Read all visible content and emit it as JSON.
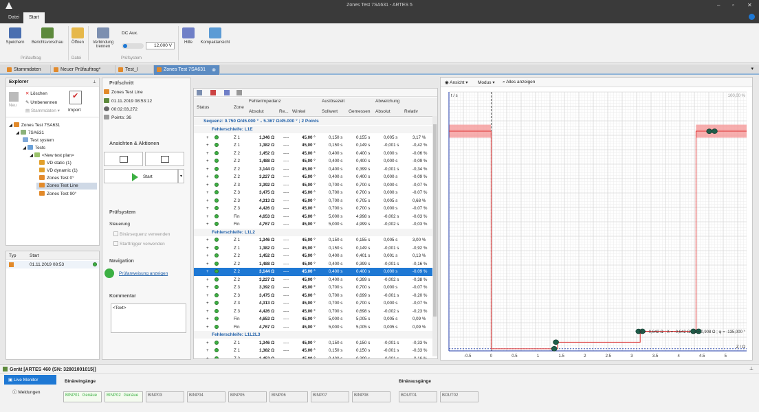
{
  "window": {
    "title": "Zones Test 7SA631 - ARTES 5"
  },
  "ribbon_tabs": [
    "Datei",
    "Start"
  ],
  "ribbon": {
    "speichern": "Speichern",
    "bericht": "Berichtsvorschau",
    "oeffnen": "Öffnen",
    "verbindung": "Verbindung trennen",
    "dc_aux": "DC Aux.",
    "dc_value": "12,000 V",
    "hilfe": "Hilfe",
    "kompakt": "Kompaktansicht",
    "grp_pruefauftrag": "Prüfauftrag",
    "grp_datei": "Datei",
    "grp_pruefsystem": "Prüfsystem"
  },
  "doc_tabs": [
    "Stammdaten",
    "Neuer Prüfauftrag*",
    "Test_I",
    "Zones Test 7SA631"
  ],
  "explorer": {
    "title": "Explorer",
    "neu": "Neu",
    "loeschen": "Löschen",
    "umbenennen": "Umbenennen",
    "stammdaten": "Stammdaten",
    "import": "Import",
    "tree": [
      "Zones Test 7SA631",
      "7SA631",
      "Test system",
      "Tests",
      "<New test plan>",
      "VD static (1)",
      "VD dynamic (1)",
      "Zones Test 0°",
      "Zones Test Line",
      "Zones Test 90°"
    ]
  },
  "history": {
    "col_typ": "Typ",
    "col_start": "Start",
    "row_start": "01.11.2019 08:53"
  },
  "pruefschritt": {
    "title": "Prüfschritt",
    "name": "Zones Test Line",
    "date": "01.11.2019 08:53:12",
    "duration": "00:02:03,272",
    "points": "Points: 36"
  },
  "aktionen": {
    "title": "Ansichten & Aktionen",
    "start": "Start"
  },
  "pruefsystem": {
    "title": "Prüfsystem",
    "steuerung": "Steuerung",
    "binaer": "Binärsequenz verwenden",
    "trigger": "Starttrigger verwenden"
  },
  "navigation": {
    "title": "Navigation",
    "link": "Prüfanweisung anzeigen"
  },
  "kommentar": {
    "title": "Kommentar",
    "text": "<Text>"
  },
  "table": {
    "headers": {
      "status": "Status",
      "zone": "Zone",
      "fehlerimpedanz": "Fehlerimpedanz",
      "absolut": "Absolut",
      "re": "Re...",
      "winkel": "Winkel",
      "ausloesezeit": "Auslösezeit",
      "sollwert": "Sollwert",
      "gemessen": "Gemessen",
      "abweichung": "Abweichung",
      "abw_abs": "Absolut",
      "relativ": "Relativ"
    },
    "sequence": "Sequenz: 0.750 Ω/45.000 ° .. 5.367 Ω/45.000 ° ; 2 Points",
    "groups": [
      {
        "name": "Fehlerschleife: L1E",
        "rows": [
          [
            "Z 1",
            "1,346 Ω",
            "45,00 °",
            "0,150 s",
            "0,155 s",
            "0,005 s",
            "3,17 %"
          ],
          [
            "Z 1",
            "1,382 Ω",
            "45,00 °",
            "0,150 s",
            "0,149 s",
            "-0,001 s",
            "-0,42 %"
          ],
          [
            "Z 2",
            "1,452 Ω",
            "45,00 °",
            "0,400 s",
            "0,400 s",
            "0,000 s",
            "-0,06 %"
          ],
          [
            "Z 2",
            "1,488 Ω",
            "45,00 °",
            "0,400 s",
            "0,400 s",
            "0,000 s",
            "-0,09 %"
          ],
          [
            "Z 2",
            "3,144 Ω",
            "45,00 °",
            "0,400 s",
            "0,399 s",
            "-0,001 s",
            "-0,34 %"
          ],
          [
            "Z 2",
            "3,227 Ω",
            "45,00 °",
            "0,400 s",
            "0,400 s",
            "0,000 s",
            "-0,09 %"
          ],
          [
            "Z 3",
            "3,392 Ω",
            "45,00 °",
            "0,700 s",
            "0,700 s",
            "0,000 s",
            "-0,07 %"
          ],
          [
            "Z 3",
            "3,475 Ω",
            "45,00 °",
            "0,700 s",
            "0,700 s",
            "0,000 s",
            "-0,07 %"
          ],
          [
            "Z 3",
            "4,313 Ω",
            "45,00 °",
            "0,700 s",
            "0,705 s",
            "0,005 s",
            "0,68 %"
          ],
          [
            "Z 3",
            "4,426 Ω",
            "45,00 °",
            "0,700 s",
            "0,700 s",
            "0,000 s",
            "-0,07 %"
          ],
          [
            "Fin",
            "4,653 Ω",
            "45,00 °",
            "5,000 s",
            "4,998 s",
            "-0,002 s",
            "-0,03 %"
          ],
          [
            "Fin",
            "4,767 Ω",
            "45,00 °",
            "5,000 s",
            "4,999 s",
            "-0,002 s",
            "-0,03 %"
          ]
        ]
      },
      {
        "name": "Fehlerschleife: L1L2",
        "rows": [
          [
            "Z 1",
            "1,346 Ω",
            "45,00 °",
            "0,150 s",
            "0,155 s",
            "0,005 s",
            "3,00 %"
          ],
          [
            "Z 1",
            "1,382 Ω",
            "45,00 °",
            "0,150 s",
            "0,149 s",
            "-0,001 s",
            "-0,92 %"
          ],
          [
            "Z 2",
            "1,452 Ω",
            "45,00 °",
            "0,400 s",
            "0,401 s",
            "0,001 s",
            "0,13 %"
          ],
          [
            "Z 2",
            "1,488 Ω",
            "45,00 °",
            "0,400 s",
            "0,399 s",
            "-0,001 s",
            "-0,16 %"
          ],
          [
            "Z 2",
            "3,144 Ω",
            "45,00 °",
            "0,400 s",
            "0,400 s",
            "0,000 s",
            "-0,09 %"
          ],
          [
            "Z 2",
            "3,227 Ω",
            "45,00 °",
            "0,400 s",
            "0,399 s",
            "-0,002 s",
            "-0,38 %"
          ],
          [
            "Z 3",
            "3,392 Ω",
            "45,00 °",
            "0,700 s",
            "0,700 s",
            "0,000 s",
            "-0,07 %"
          ],
          [
            "Z 3",
            "3,475 Ω",
            "45,00 °",
            "0,700 s",
            "0,699 s",
            "-0,001 s",
            "-0,20 %"
          ],
          [
            "Z 3",
            "4,313 Ω",
            "45,00 °",
            "0,700 s",
            "0,700 s",
            "0,000 s",
            "-0,07 %"
          ],
          [
            "Z 3",
            "4,426 Ω",
            "45,00 °",
            "0,700 s",
            "0,698 s",
            "-0,002 s",
            "-0,23 %"
          ],
          [
            "Fin",
            "4,653 Ω",
            "45,00 °",
            "5,000 s",
            "5,005 s",
            "0,005 s",
            "0,09 %"
          ],
          [
            "Fin",
            "4,767 Ω",
            "45,00 °",
            "5,000 s",
            "5,005 s",
            "0,005 s",
            "0,09 %"
          ]
        ]
      },
      {
        "name": "Fehlerschleife: L1L2L3",
        "rows": [
          [
            "Z 1",
            "1,346 Ω",
            "45,00 °",
            "0,150 s",
            "0,150 s",
            "-0,001 s",
            "-0,33 %"
          ],
          [
            "Z 1",
            "1,382 Ω",
            "45,00 °",
            "0,150 s",
            "0,150 s",
            "-0,001 s",
            "-0,33 %"
          ],
          [
            "Z 2",
            "1,452 Ω",
            "45,00 °",
            "0,400 s",
            "0,399 s",
            "-0,001 s",
            "-0,16 %"
          ]
        ]
      }
    ],
    "dash": "----",
    "selected_row": "1.4"
  },
  "chart_toolbar": {
    "ansicht": "Ansicht",
    "modus": "Modus",
    "alles": "Alles anzeigen"
  },
  "chart_data": {
    "type": "line",
    "ylabel": "t / s",
    "xlabel": "Z / Ω",
    "zoom": "100,00 %",
    "xticks": [
      "-0.5",
      "0",
      "0.5",
      "1",
      "1.5",
      "2",
      "2.5",
      "3",
      "3.5",
      "4",
      "4.5",
      "5"
    ],
    "xtick_values": [
      -0.5,
      0,
      0.5,
      1,
      1.5,
      2,
      2.5,
      3,
      3.5,
      4,
      4.5,
      5
    ],
    "xlim": [
      -0.9,
      5.45
    ],
    "ylim": [
      -0.05,
      5.9
    ],
    "characteristic": [
      {
        "x": -0.9,
        "y": 5
      },
      {
        "x": 0,
        "y": 5
      },
      {
        "x": 0,
        "y": 0
      },
      {
        "x": 1.414,
        "y": 0
      },
      {
        "x": 1.414,
        "y": 0.15
      },
      {
        "x": 3.18,
        "y": 0.15
      },
      {
        "x": 3.18,
        "y": 0.4
      },
      {
        "x": 4.37,
        "y": 0.4
      },
      {
        "x": 4.37,
        "y": 5
      },
      {
        "x": 5.45,
        "y": 5
      }
    ],
    "points": [
      {
        "x": 1.346,
        "y": 0.0
      },
      {
        "x": 1.382,
        "y": 0.15
      },
      {
        "x": 3.144,
        "y": 0.399
      },
      {
        "x": 3.227,
        "y": 0.4
      },
      {
        "x": 4.313,
        "y": 0.4
      },
      {
        "x": 4.426,
        "y": 0.4
      },
      {
        "x": 4.653,
        "y": 4.998
      },
      {
        "x": 4.767,
        "y": 4.999
      }
    ],
    "cursor_text": "R = -0,642 Ω ; X = -0,642 Ω ; Z = 0,908 Ω ; φ = -135,000 °"
  },
  "device": {
    "title": "Gerät [ARTES 460 (SN: 32801001015)]",
    "live": "Live Monitor",
    "meldungen": "Meldungen",
    "in_title": "Binäreingänge",
    "out_title": "Binärausgänge",
    "inputs": [
      "BINP01",
      "BINP02",
      "BINP03",
      "BINP04",
      "BINP05",
      "BINP06",
      "BINP07",
      "BINP08"
    ],
    "generic": "Genäue",
    "outputs": [
      "BOUT01",
      "BOUT02"
    ]
  }
}
